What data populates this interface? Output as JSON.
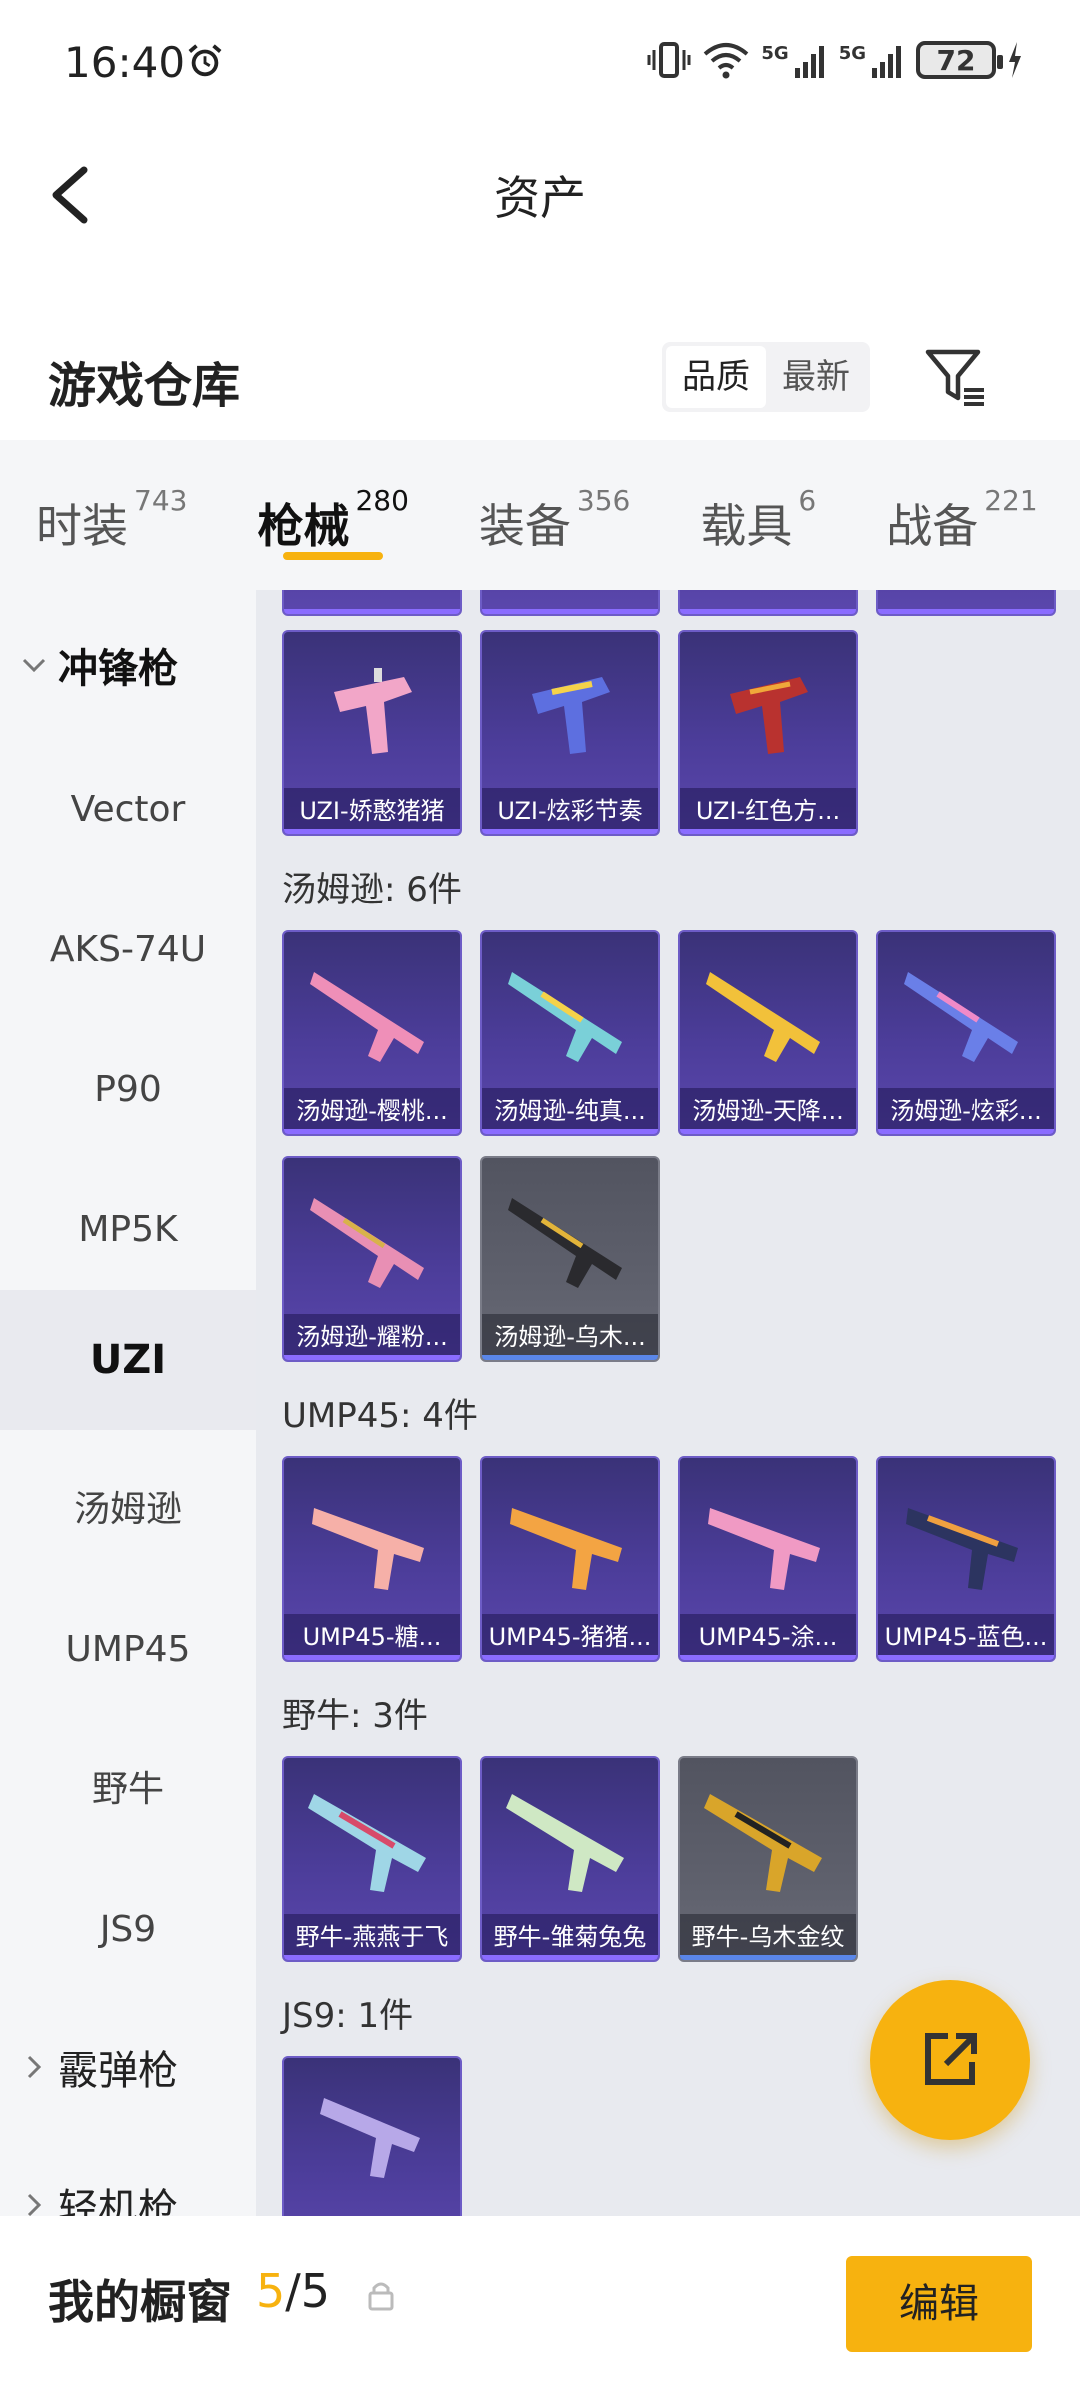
{
  "status_bar": {
    "time": "16:40",
    "battery": "72",
    "network1": "5G",
    "network2": "5G"
  },
  "nav": {
    "title": "资产"
  },
  "warehouse": {
    "title": "游戏仓库",
    "sort_quality": "品质",
    "sort_latest": "最新"
  },
  "tabs": [
    {
      "label": "时装",
      "count": "743"
    },
    {
      "label": "枪械",
      "count": "280"
    },
    {
      "label": "装备",
      "count": "356"
    },
    {
      "label": "载具",
      "count": "6"
    },
    {
      "label": "战备",
      "count": "221"
    }
  ],
  "sidebar": {
    "group_smg": "冲锋枪",
    "items": [
      "Vector",
      "AKS-74U",
      "P90",
      "MP5K",
      "UZI",
      "汤姆逊",
      "UMP45",
      "野牛",
      "JS9"
    ],
    "group_shotgun": "霰弹枪",
    "group_lmg": "轻机枪"
  },
  "content": {
    "uzi_cards": [
      "UZI-娇憨猪猪",
      "UZI-炫彩节奏",
      "UZI-红色方..."
    ],
    "thompson_label": "汤姆逊: 6件",
    "thompson_cards": [
      "汤姆逊-樱桃...",
      "汤姆逊-纯真...",
      "汤姆逊-天降...",
      "汤姆逊-炫彩...",
      "汤姆逊-耀粉...",
      "汤姆逊-乌木..."
    ],
    "ump_label": "UMP45: 4件",
    "ump_cards": [
      "UMP45-糖...",
      "UMP45-猪猪...",
      "UMP45-涂...",
      "UMP45-蓝色..."
    ],
    "bizon_label": "野牛: 3件",
    "bizon_cards": [
      "野牛-燕燕于飞",
      "野牛-雏菊兔兔",
      "野牛-乌木金纹"
    ],
    "js9_label": "JS9: 1件"
  },
  "bottom": {
    "showcase_label": "我的橱窗",
    "showcase_current": "5",
    "showcase_sep": "/",
    "showcase_total": "5",
    "edit_label": "编辑"
  },
  "colors": {
    "accent": "#f7b20f",
    "card_purple": "#4c3d9a",
    "card_gray": "#5e606c"
  }
}
